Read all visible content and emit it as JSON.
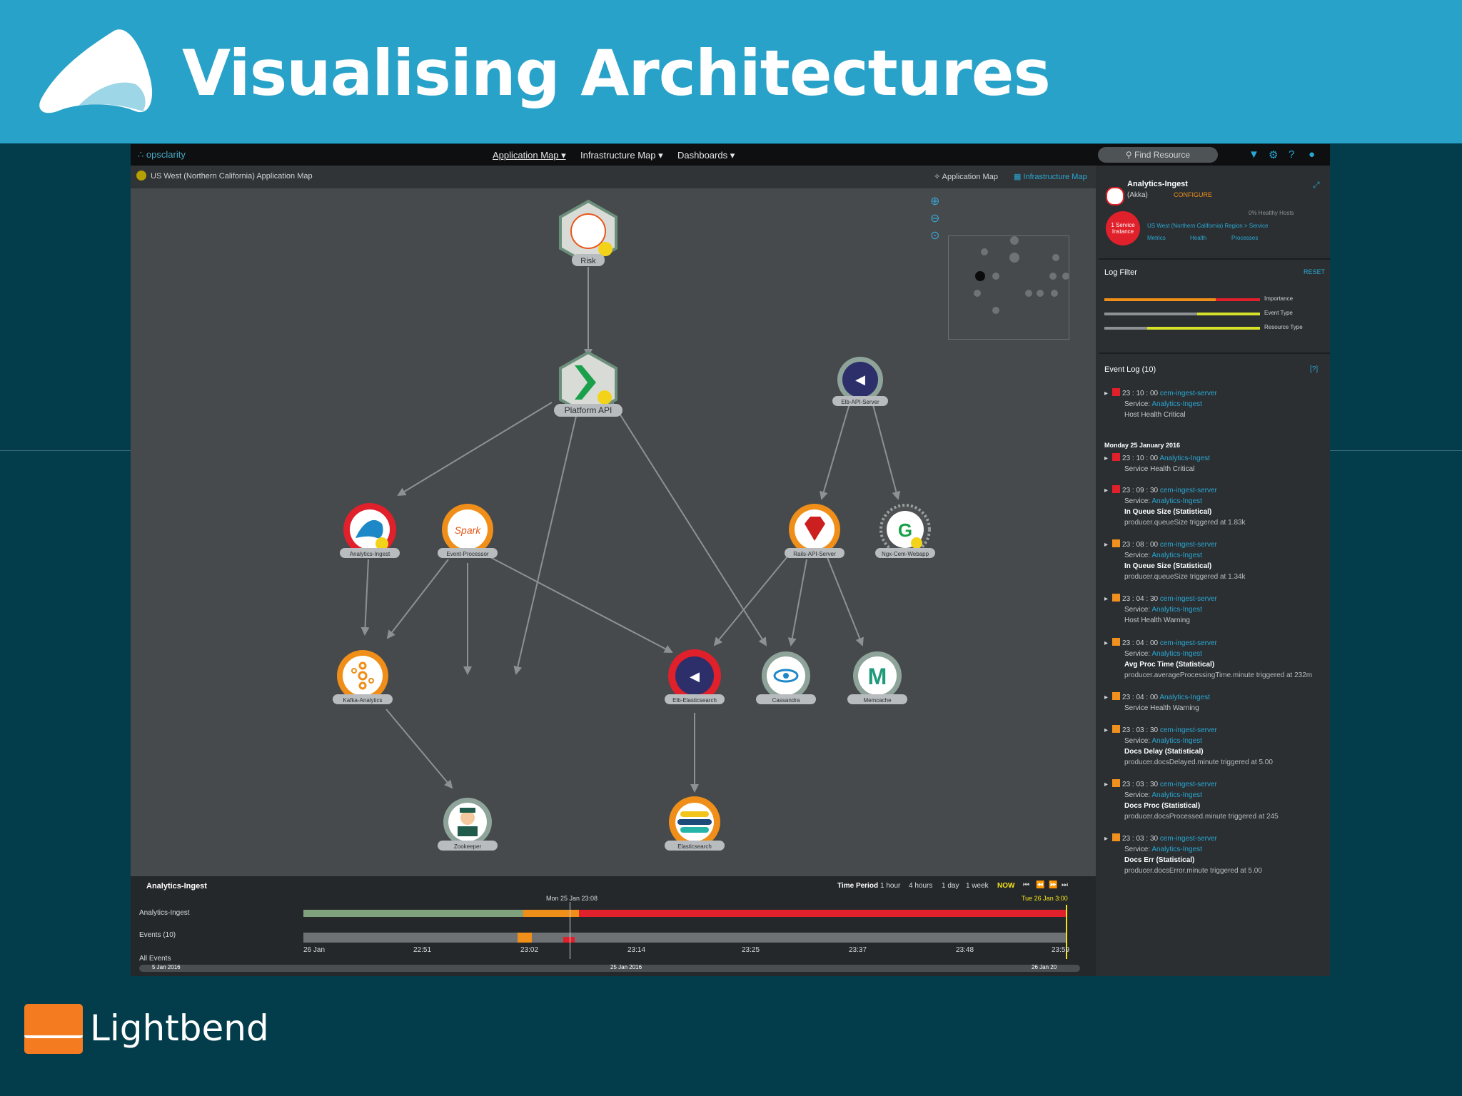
{
  "slide": {
    "title": "Visualising Architectures",
    "logo_icon": "triangle-wave-logo-icon",
    "footer_brand": "Lightbend",
    "colors": {
      "banner": "#28a2c8",
      "background": "#033d4b",
      "footer_logo": "#f47b20"
    }
  },
  "app": {
    "brand": "opsclarity",
    "nav": [
      "Application Map ▾",
      "Infrastructure Map ▾",
      "Dashboards ▾"
    ],
    "search_placeholder": "Find Resource",
    "map_title": "US West (Northern California) Application Map",
    "view_links": [
      "Application Map",
      "Infrastructure Map"
    ]
  },
  "nodes": [
    {
      "label": "Risk",
      "status": "warning"
    },
    {
      "label": "Platform API",
      "status": "warning"
    },
    {
      "label": "Elb-API-Server",
      "status": "ok"
    },
    {
      "label": "Analytics-Ingest",
      "status": "critical"
    },
    {
      "label": "Event-Processor",
      "status": "warning"
    },
    {
      "label": "Rails-API-Server",
      "status": "warning"
    },
    {
      "label": "Ngx-Cem-Webapp",
      "status": "ok"
    },
    {
      "label": "Kafka-Analytics",
      "status": "warning"
    },
    {
      "label": "Elb-Elasticsearch",
      "status": "critical"
    },
    {
      "label": "Cassandra",
      "status": "ok"
    },
    {
      "label": "Memcache",
      "status": "ok"
    },
    {
      "label": "Zookeeper",
      "status": "ok"
    },
    {
      "label": "Elasticsearch",
      "status": "warning"
    }
  ],
  "timeline": {
    "resource": "Analytics-Ingest",
    "time_period_label": "Time Period",
    "periods": [
      "1 hour",
      "4 hours",
      "1 day",
      "1 week",
      "NOW"
    ],
    "controls": [
      "⏮",
      "⏪",
      "⏩",
      "⏭"
    ],
    "current_marker": "Mon 25 Jan 23:08",
    "end_marker": "Tue 26 Jan 3:00",
    "rows": [
      "Analytics-Ingest",
      "Events (10)",
      "All Events"
    ],
    "ticks": [
      "26 Jan",
      "22:51",
      "23:02",
      "23:14",
      "23:25",
      "23:37",
      "23:48",
      "23:59"
    ],
    "range_labels": [
      "5 Jan 2016",
      "25 Jan 2016",
      "26 Jan 20"
    ]
  },
  "panel": {
    "resource": "Analytics-Ingest",
    "type": "(Akka)",
    "configure": "CONFIGURE",
    "healthy_hosts": "0% Healthy Hosts",
    "badge": "1 Service Instance",
    "breadcrumb": "US West (Northern California) Region > Service",
    "links": [
      "Metrics",
      "Health",
      "Processes"
    ],
    "log_filter_title": "Log Filter",
    "reset": "RESET",
    "filters": [
      "Importance",
      "Event Type",
      "Resource Type"
    ],
    "event_log_title": "Event Log (10)",
    "help": "[?]",
    "date_header": "Monday 25 January 2016",
    "events": [
      {
        "time": "23 : 10 : 00",
        "source": "cem-ingest-server",
        "service": "Service:",
        "service_link": "Analytics-Ingest",
        "title": "Host Health Critical",
        "detail": "",
        "color": "#e0202a"
      },
      {
        "time": "23 : 10 : 00",
        "source": "Analytics-Ingest",
        "service": "",
        "service_link": "",
        "title": "Service Health Critical",
        "detail": "",
        "color": "#e0202a"
      },
      {
        "time": "23 : 09 : 30",
        "source": "cem-ingest-server",
        "service": "Service:",
        "service_link": "Analytics-Ingest",
        "title": "In Queue Size (Statistical)",
        "detail": "producer.queueSize triggered at 1.83k",
        "color": "#e0202a"
      },
      {
        "time": "23 : 08 : 00",
        "source": "cem-ingest-server",
        "service": "Service:",
        "service_link": "Analytics-Ingest",
        "title": "In Queue Size (Statistical)",
        "detail": "producer.queueSize triggered at 1.34k",
        "color": "#f0901e"
      },
      {
        "time": "23 : 04 : 30",
        "source": "cem-ingest-server",
        "service": "Service:",
        "service_link": "Analytics-Ingest",
        "title": "Host Health Warning",
        "detail": "",
        "color": "#f0901e"
      },
      {
        "time": "23 : 04 : 00",
        "source": "cem-ingest-server",
        "service": "Service:",
        "service_link": "Analytics-Ingest",
        "title": "Avg Proc Time (Statistical)",
        "detail": "producer.averageProcessingTime.minute triggered at 232m",
        "color": "#f0901e"
      },
      {
        "time": "23 : 04 : 00",
        "source": "Analytics-Ingest",
        "service": "",
        "service_link": "",
        "title": "Service Health Warning",
        "detail": "",
        "color": "#f0901e"
      },
      {
        "time": "23 : 03 : 30",
        "source": "cem-ingest-server",
        "service": "Service:",
        "service_link": "Analytics-Ingest",
        "title": "Docs Delay (Statistical)",
        "detail": "producer.docsDelayed.minute triggered at 5.00",
        "color": "#f0901e"
      },
      {
        "time": "23 : 03 : 30",
        "source": "cem-ingest-server",
        "service": "Service:",
        "service_link": "Analytics-Ingest",
        "title": "Docs Proc (Statistical)",
        "detail": "producer.docsProcessed.minute triggered at 245",
        "color": "#f0901e"
      },
      {
        "time": "23 : 03 : 30",
        "source": "cem-ingest-server",
        "service": "Service:",
        "service_link": "Analytics-Ingest",
        "title": "Docs Err (Statistical)",
        "detail": "producer.docsError.minute triggered at 5.00",
        "color": "#f0901e"
      }
    ]
  }
}
